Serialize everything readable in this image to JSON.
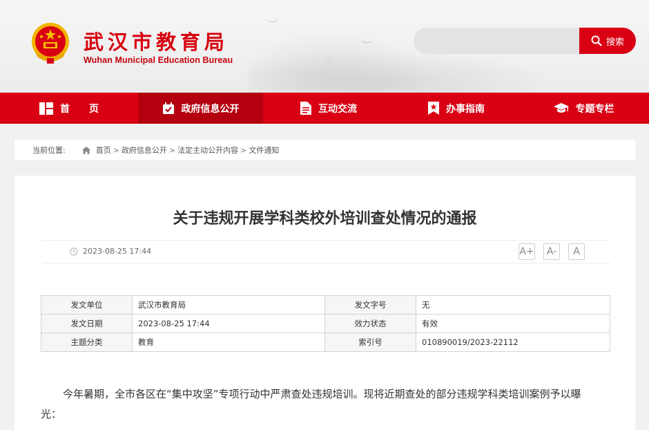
{
  "header": {
    "site_title": "武汉市教育局",
    "site_subtitle": "Wuhan Municipal Education Bureau",
    "emblem_icon": "national-emblem-icon",
    "search": {
      "placeholder": "",
      "button_label": "搜索",
      "icon": "search-icon"
    }
  },
  "nav": {
    "items": [
      {
        "label": "首　　页",
        "icon": "home-grid-icon"
      },
      {
        "label": "政府信息公开",
        "icon": "calendar-check-icon"
      },
      {
        "label": "互动交流",
        "icon": "document-icon"
      },
      {
        "label": "办事指南",
        "icon": "bookmark-star-icon"
      },
      {
        "label": "专题专栏",
        "icon": "graduation-cap-icon"
      }
    ],
    "active_index": 1
  },
  "breadcrumb": {
    "label": "当前位置:",
    "items": [
      "首页",
      "政府信息公开",
      "法定主动公开内容",
      "文件通知"
    ]
  },
  "article": {
    "title": "关于违规开展学科类校外培训查处情况的通报",
    "date": "2023-08-25 17:44",
    "font_buttons": [
      "A+",
      "A-",
      "A"
    ],
    "info_table": [
      {
        "k1": "发文单位",
        "v1": "武汉市教育局",
        "k2": "发文字号",
        "v2": "无"
      },
      {
        "k1": "发文日期",
        "v1": "2023-08-25 17:44",
        "k2": "效力状态",
        "v2": "有效"
      },
      {
        "k1": "主题分类",
        "v1": "教育",
        "k2": "索引号",
        "v2": "010890019/2023-22112"
      }
    ],
    "body": "今年暑期，全市各区在“集中攻坚”专项行动中严肃查处违规培训。现将近期查处的部分违规学科类培训案例予以曝光："
  },
  "colors": {
    "brand_red": "#d90014",
    "nav_active": "#b4000e",
    "title_red": "#d7000f"
  }
}
